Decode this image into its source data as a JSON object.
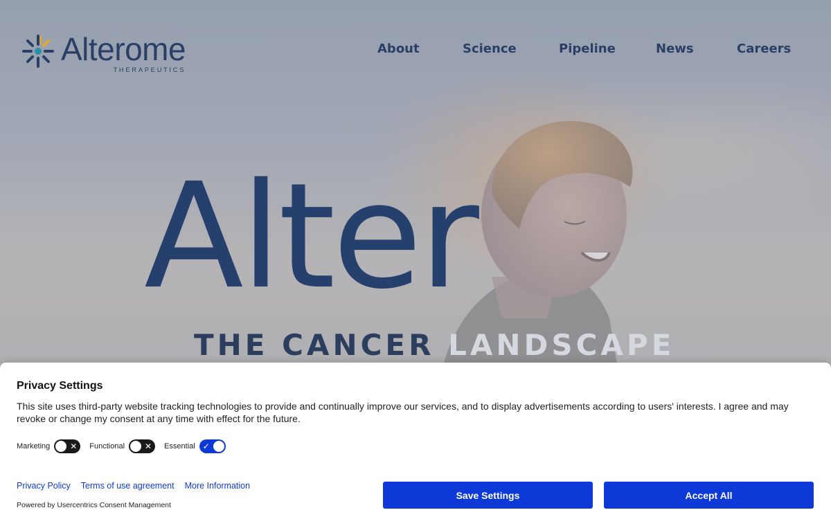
{
  "brand": {
    "name": "Alterome",
    "subtitle": "THERAPEUTICS",
    "logo_icon": "asterisk-burst-logo-icon",
    "primary_color": "#2b3f66",
    "accent_color": "#e0a82e"
  },
  "nav": {
    "items": [
      {
        "label": "About"
      },
      {
        "label": "Science"
      },
      {
        "label": "Pipeline"
      },
      {
        "label": "News"
      },
      {
        "label": "Careers"
      }
    ]
  },
  "hero": {
    "headline": "Alter",
    "tagline_dark": "THE CANCER ",
    "tagline_light": "LANDSCAPE"
  },
  "consent": {
    "title": "Privacy Settings",
    "description": "This site uses third-party website tracking technologies to provide and continually improve our services, and to display advertisements according to users' interests. I agree and may revoke or change my consent at any time with effect for the future.",
    "toggles": [
      {
        "label": "Marketing",
        "state": "off",
        "icon": "x-icon"
      },
      {
        "label": "Functional",
        "state": "off",
        "icon": "x-icon"
      },
      {
        "label": "Essential",
        "state": "on",
        "icon": "check-icon"
      }
    ],
    "links": {
      "privacy": "Privacy Policy",
      "terms": "Terms of use agreement",
      "more": "More Information"
    },
    "powered_by": "Powered by Usercentrics Consent Management",
    "save_label": "Save Settings",
    "accept_label": "Accept All",
    "button_color": "#0d3ad6"
  }
}
